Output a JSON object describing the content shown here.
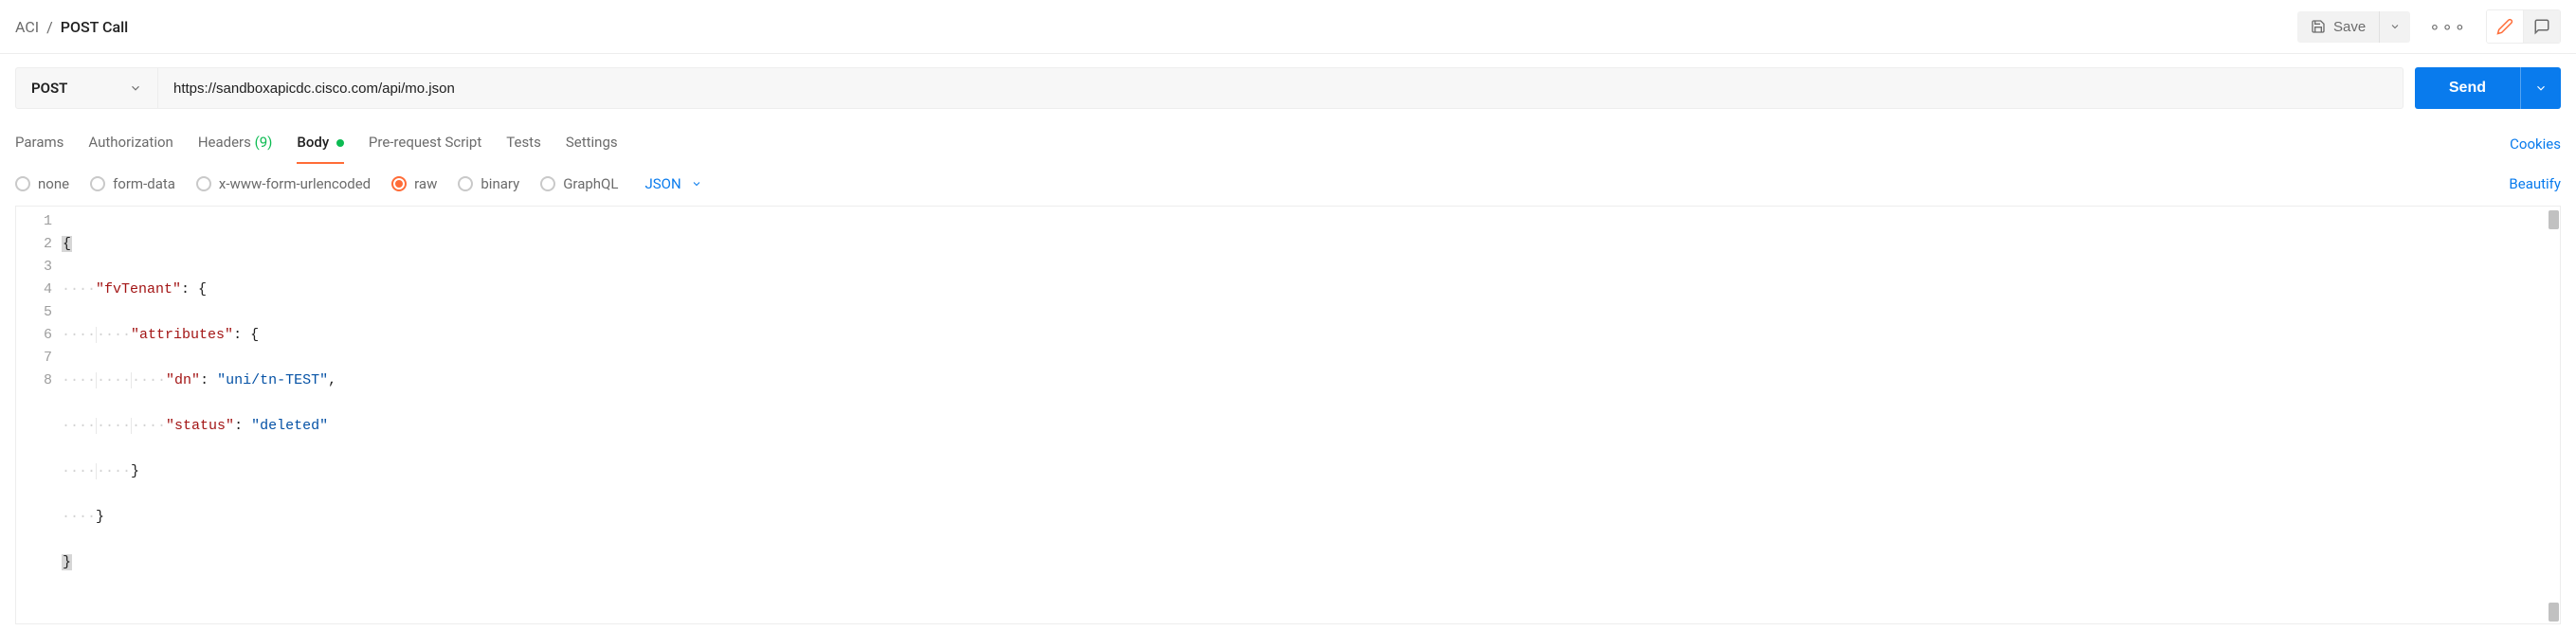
{
  "breadcrumb": {
    "root": "ACI",
    "sep": "/",
    "current": "POST Call"
  },
  "top": {
    "save": "Save"
  },
  "request": {
    "method": "POST",
    "url": "https://sandboxapicdc.cisco.com/api/mo.json",
    "send": "Send"
  },
  "tabs": {
    "params": "Params",
    "auth": "Authorization",
    "headers_label": "Headers",
    "headers_count": "(9)",
    "body": "Body",
    "prereq": "Pre-request Script",
    "tests": "Tests",
    "settings": "Settings",
    "cookies": "Cookies"
  },
  "body_opts": {
    "none": "none",
    "formdata": "form-data",
    "urlenc": "x-www-form-urlencoded",
    "raw": "raw",
    "binary": "binary",
    "graphql": "GraphQL",
    "type": "JSON",
    "beautify": "Beautify"
  },
  "editor": {
    "lines": [
      "1",
      "2",
      "3",
      "4",
      "5",
      "6",
      "7",
      "8"
    ],
    "l1_open": "{",
    "l2_key": "\"fvTenant\"",
    "l2_colon": ": ",
    "l2_open": "{",
    "l3_key": "\"attributes\"",
    "l3_colon": ": ",
    "l3_open": "{",
    "l4_key": "\"dn\"",
    "l4_colon": ": ",
    "l4_val": "\"uni/tn-TEST\"",
    "l4_comma": ",",
    "l5_key": "\"status\"",
    "l5_colon": ": ",
    "l5_val": "\"deleted\"",
    "l6_close": "}",
    "l7_close": "}",
    "l8_close": "}"
  }
}
